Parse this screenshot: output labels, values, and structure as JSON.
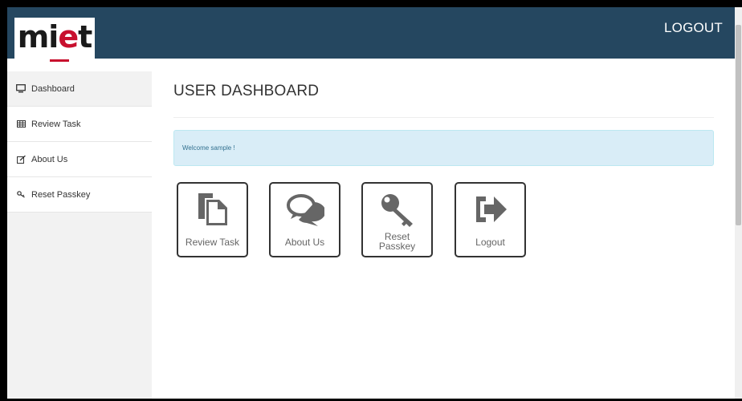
{
  "header": {
    "logo_text": "miet",
    "logout_label": "LOGOUT"
  },
  "sidebar": {
    "items": [
      {
        "label": "Dashboard",
        "icon": "monitor-icon",
        "active": true
      },
      {
        "label": "Review Task",
        "icon": "table-icon"
      },
      {
        "label": "About Us",
        "icon": "edit-icon"
      },
      {
        "label": "Reset Passkey",
        "icon": "key-icon"
      }
    ]
  },
  "main": {
    "title": "USER DASHBOARD",
    "welcome": "Welcome sample !",
    "tiles": [
      {
        "label": "Review Task",
        "icon": "documents-icon"
      },
      {
        "label": "About Us",
        "icon": "comments-icon"
      },
      {
        "label": "Reset Passkey",
        "icon": "key-icon"
      },
      {
        "label": "Logout",
        "icon": "sign-out-icon"
      }
    ]
  },
  "colors": {
    "navbar": "#254760",
    "alert_bg": "#d9edf7",
    "logo_accent": "#c8102e"
  }
}
